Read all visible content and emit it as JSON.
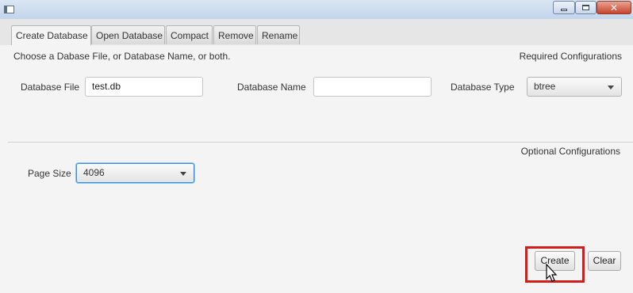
{
  "window": {
    "title": "",
    "controls": [
      "minimize",
      "maximize",
      "close"
    ],
    "icon": "app-window-icon"
  },
  "tabs": [
    {
      "label": "Create Database",
      "active": true
    },
    {
      "label": "Open Database",
      "active": false
    },
    {
      "label": "Compact",
      "active": false
    },
    {
      "label": "Remove",
      "active": false
    },
    {
      "label": "Rename",
      "active": false
    }
  ],
  "create": {
    "hint": "Choose a Dabase File, or Database Name, or both.",
    "required_label": "Required Configurations",
    "optional_label": "Optional Configurations",
    "db_file": {
      "label": "Database File",
      "value": "test.db"
    },
    "db_name": {
      "label": "Database Name",
      "value": ""
    },
    "db_type": {
      "label": "Database Type",
      "value": "btree"
    },
    "page_size": {
      "label": "Page Size",
      "value": "4096"
    },
    "buttons": {
      "create": "Create",
      "clear": "Clear"
    }
  },
  "colors": {
    "highlight": "#d31d1d",
    "focus": "#3a8fd6",
    "background": "#f4f4f4"
  }
}
